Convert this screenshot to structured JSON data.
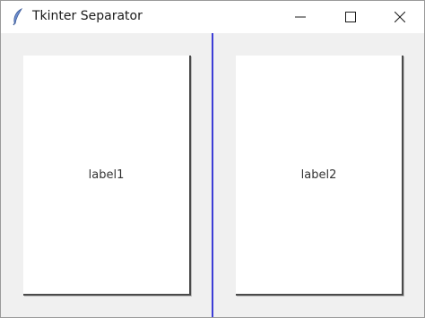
{
  "window": {
    "title": "Tkinter Separator"
  },
  "titlebar": {
    "icon": "feather-icon",
    "controls": [
      "minimize-icon",
      "maximize-icon",
      "close-icon"
    ]
  },
  "panels": [
    {
      "label": "label1"
    },
    {
      "label": "label2"
    }
  ],
  "colors": {
    "separator": "#3d3dd6",
    "window_bg": "#f0f0f0",
    "panel_bg": "#ffffff"
  }
}
